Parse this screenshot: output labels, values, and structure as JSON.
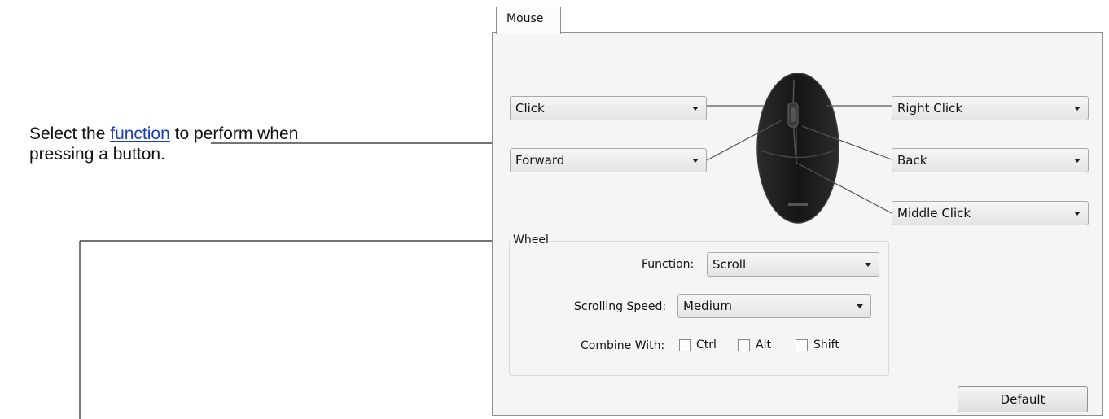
{
  "annotations": {
    "select_prefix": "Select the ",
    "select_link": "function",
    "select_suffix": " to perform when",
    "select_line2": "pressing a button."
  },
  "tabs": [
    {
      "label": "Mouse",
      "active": true
    }
  ],
  "buttons": {
    "left_top": "Click",
    "left_bottom": "Forward",
    "right_top": "Right Click",
    "right_middle": "Back",
    "right_bottom": "Middle Click"
  },
  "wheel": {
    "legend": "Wheel",
    "function_label": "Function:",
    "function_value": "Scroll",
    "speed_label": "Scrolling Speed:",
    "speed_value": "Medium",
    "combine_label": "Combine With:",
    "modifiers": [
      "Ctrl",
      "Alt",
      "Shift"
    ]
  },
  "default_button": "Default",
  "colors": {
    "panel": "#f5f5f5",
    "border": "#8e8e8e",
    "link": "#1a3fb3",
    "mouse_body": "#1e1e1e"
  }
}
